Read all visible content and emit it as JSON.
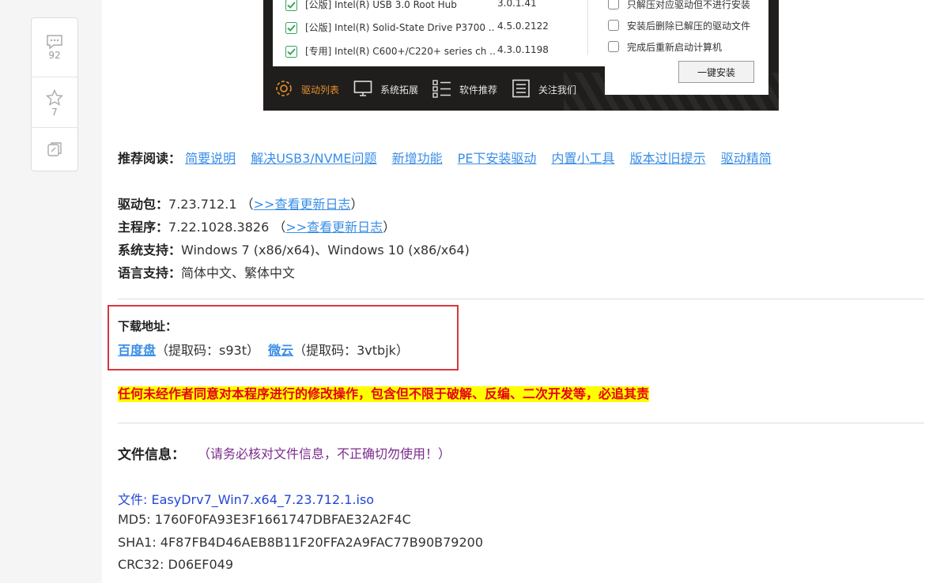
{
  "sidebar": {
    "comment_count": "92",
    "favorite_count": "7"
  },
  "screenshot": {
    "drivers": [
      {
        "name": "[公版] Intel(R) USB 3.0 Root Hub",
        "version": "3.0.1.41"
      },
      {
        "name": "[公版] Intel(R) Solid-State Drive P3700 ..",
        "version": "4.5.0.2122"
      },
      {
        "name": "[专用] Intel(R) C600+/C220+ series ch ..",
        "version": "4.3.0.1198"
      }
    ],
    "options": [
      "只解压对应驱动但不进行安装",
      "安装后删除已解压的驱动文件",
      "完成后重新启动计算机"
    ],
    "install_button": "一键安装",
    "tabs": [
      "驱动列表",
      "系统拓展",
      "软件推荐",
      "关注我们"
    ]
  },
  "recommend": {
    "label": "推荐阅读：",
    "links": [
      "简要说明",
      "解决USB3/NVME问题",
      "新增功能",
      "PE下安装驱动",
      "内置小工具",
      "版本过旧提示",
      "驱动精简"
    ]
  },
  "info": {
    "driver_pack_label": "驱动包：",
    "driver_pack_version": "7.23.712.1",
    "main_program_label": "主程序：",
    "main_program_version": "7.22.1028.3826",
    "changelog_link": ">>查看更新日志",
    "paren_open": "（",
    "paren_close": "）",
    "system_label": "系统支持：",
    "system_value": "Windows 7 (x86/x64)、Windows 10 (x86/x64)",
    "language_label": "语言支持：",
    "language_value": "简体中文、繁体中文"
  },
  "download": {
    "label": "下载地址：",
    "baidu_link": "百度盘",
    "baidu_code": "（提取码：s93t）",
    "weiyun_link": "微云",
    "weiyun_code": "（提取码：3vtbjk）"
  },
  "warning": "任何未经作者同意对本程序进行的修改操作，包含但不限于破解、反编、二次开发等，必追其责",
  "file_info": {
    "title": "文件信息：",
    "note": "（请务必核对文件信息，不正确切勿使用！）",
    "file": "文件: EasyDrv7_Win7.x64_7.23.712.1.iso",
    "md5": "MD5: 1760F0FA93E3F1661747DBFAE32A2F4C",
    "sha1": "SHA1: 4F87FB4D46AEB8B11F20FFA2A9FAC77B90B79200",
    "crc32": "CRC32: D06EF049"
  },
  "colors": {
    "link": "#3a8ee6",
    "warning_text": "#e60012",
    "warning_bg": "#ffff00",
    "download_box_border": "#d9363e",
    "file_note": "#7b2a8c"
  }
}
